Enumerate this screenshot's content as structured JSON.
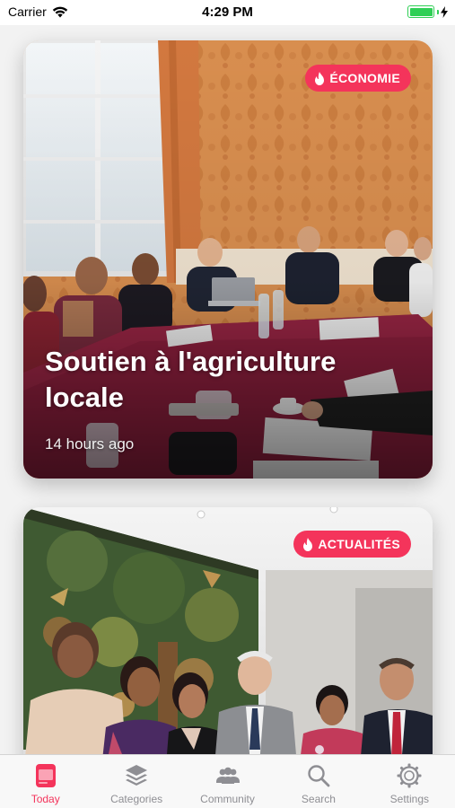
{
  "status_bar": {
    "carrier": "Carrier",
    "time": "4:29 PM",
    "battery_level": 1.0
  },
  "feed": {
    "cards": [
      {
        "category": "ÉCONOMIE",
        "category_icon": "flame-icon",
        "title": "Soutien à l'agriculture locale",
        "time_ago": "14 hours ago"
      },
      {
        "category": "ACTUALITÉS",
        "category_icon": "flame-icon"
      }
    ]
  },
  "tab_bar": {
    "items": [
      {
        "label": "Today",
        "icon": "today-icon",
        "active": true
      },
      {
        "label": "Categories",
        "icon": "layers-icon",
        "active": false
      },
      {
        "label": "Community",
        "icon": "people-icon",
        "active": false
      },
      {
        "label": "Search",
        "icon": "search-icon",
        "active": false
      },
      {
        "label": "Settings",
        "icon": "gear-icon",
        "active": false
      }
    ]
  },
  "colors": {
    "accent": "#f4345b",
    "tab_inactive": "#8e8e93",
    "battery": "#2fcf55"
  }
}
